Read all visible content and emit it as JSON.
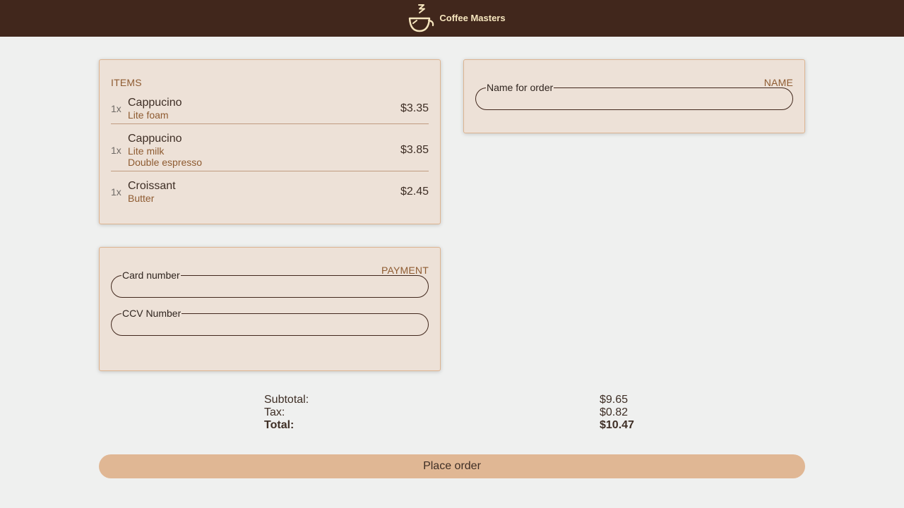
{
  "app": {
    "brand_name": "Coffee Masters",
    "logo_icon": "coffee-cup-icon",
    "colors": {
      "header_bg": "#41271c",
      "brand_text": "#f6e6be",
      "card_bg": "#ede1d7",
      "accent_text": "#8e5b31",
      "button_bg": "#e0b794"
    }
  },
  "items": {
    "section_label": "ITEMS",
    "list": [
      {
        "qty": "1x",
        "name": "Cappucino",
        "options": [
          "Lite foam"
        ],
        "price": "$3.35"
      },
      {
        "qty": "1x",
        "name": "Cappucino",
        "options": [
          "Lite milk",
          "Double espresso"
        ],
        "price": "$3.85"
      },
      {
        "qty": "1x",
        "name": "Croissant",
        "options": [
          "Butter"
        ],
        "price": "$2.45"
      }
    ]
  },
  "name_section": {
    "section_label": "NAME",
    "field_label": "Name for order",
    "value": ""
  },
  "payment": {
    "section_label": "PAYMENT",
    "card_label": "Card number",
    "card_value": "",
    "ccv_label": "CCV Number",
    "ccv_value": ""
  },
  "totals": {
    "subtotal_label": "Subtotal:",
    "subtotal_value": "$9.65",
    "tax_label": "Tax:",
    "tax_value": "$0.82",
    "total_label": "Total:",
    "total_value": "$10.47"
  },
  "actions": {
    "place_order_label": "Place order"
  }
}
